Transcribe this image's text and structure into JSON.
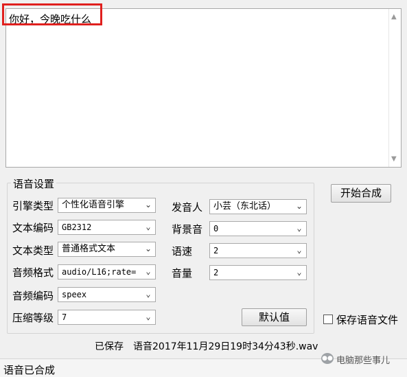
{
  "textarea": {
    "value": "你好，今晚吃什么"
  },
  "group_title": "语音设置",
  "fields": {
    "engine_type": {
      "label": "引擎类型",
      "value": "个性化语音引擎"
    },
    "text_encoding": {
      "label": "文本编码",
      "value": "GB2312"
    },
    "text_type": {
      "label": "文本类型",
      "value": "普通格式文本"
    },
    "audio_format": {
      "label": "音频格式",
      "value": "audio/L16;rate="
    },
    "audio_codec": {
      "label": "音频编码",
      "value": "speex"
    },
    "compression_level": {
      "label": "压缩等级",
      "value": "7"
    },
    "speaker": {
      "label": "发音人",
      "value": "小芸（东北话）"
    },
    "background_sound": {
      "label": "背景音",
      "value": "0"
    },
    "speed": {
      "label": "语速",
      "value": "2"
    },
    "volume": {
      "label": "音量",
      "value": "2"
    }
  },
  "buttons": {
    "default": "默认值",
    "start": "开始合成"
  },
  "save_checkbox": {
    "label": "保存语音文件",
    "checked": false
  },
  "saved_text": "已保存　语音2017年11月29日19时34分43秒.wav",
  "status": "语音已合成",
  "watermark": "电脑那些事儿",
  "icons": {
    "dropdown": "chevron-down-icon",
    "scroll_up": "scroll-up-icon",
    "scroll_down": "scroll-down-icon"
  },
  "colors": {
    "highlight": "#e0201e",
    "background": "#f0f0f0"
  }
}
